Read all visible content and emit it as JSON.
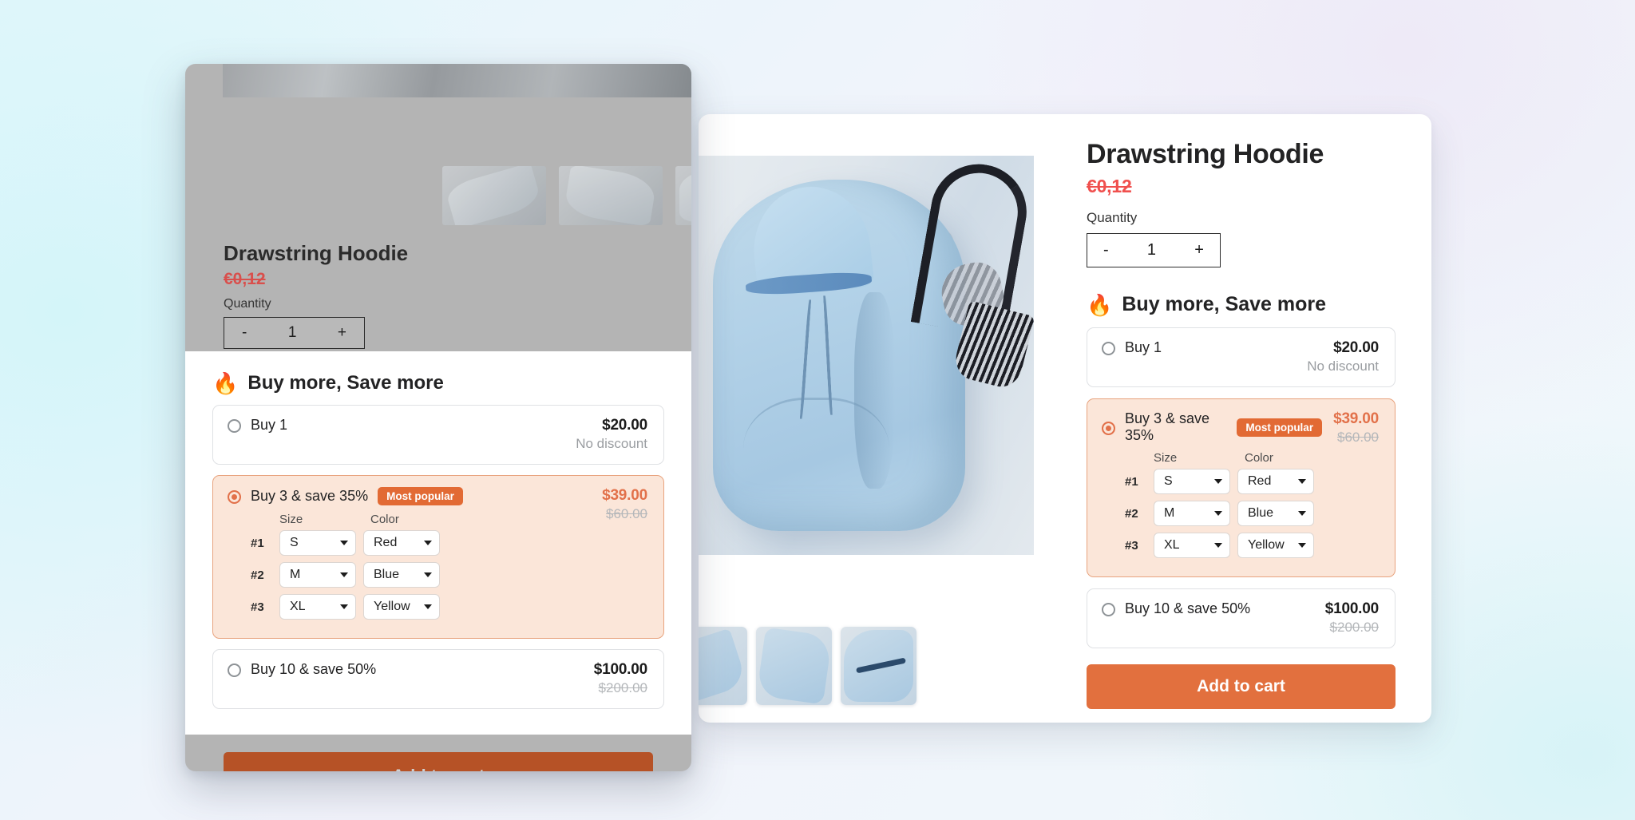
{
  "background": {
    "accent_cyan": "#d4f5f9",
    "accent_lavender": "#eeeaf7"
  },
  "product": {
    "title": "Drawstring Hoodie",
    "price": "€0,12",
    "quantity_label": "Quantity",
    "quantity_minus": "-",
    "quantity_value": "1",
    "quantity_plus": "+"
  },
  "offers": {
    "heading": "Buy more, Save more",
    "flame_icon": "🔥",
    "tiers": [
      {
        "label": "Buy 1",
        "badge": null,
        "price": "$20.00",
        "sub": "No discount",
        "old_price": null,
        "selected": false
      },
      {
        "label": "Buy 3 & save 35%",
        "badge": "Most popular",
        "price": "$39.00",
        "sub": null,
        "old_price": "$60.00",
        "selected": true,
        "variants": {
          "size_header": "Size",
          "color_header": "Color",
          "rows": [
            {
              "index": "#1",
              "size": "S",
              "color": "Red"
            },
            {
              "index": "#2",
              "size": "M",
              "color": "Blue"
            },
            {
              "index": "#3",
              "size": "XL",
              "color": "Yellow"
            }
          ]
        }
      },
      {
        "label": "Buy 10 & save 50%",
        "badge": null,
        "price": "$100.00",
        "sub": null,
        "old_price": "$200.00",
        "selected": false
      }
    ]
  },
  "cta": {
    "add_to_cart": "Add to cart"
  },
  "colors": {
    "orange": "#e2703e",
    "badge_orange": "#e26a34",
    "tier_selected_bg": "#fbe6d9",
    "tier_selected_border": "#e8a37e",
    "sale_price_red": "#f0504e",
    "dimmed_cta": "#b65226"
  }
}
